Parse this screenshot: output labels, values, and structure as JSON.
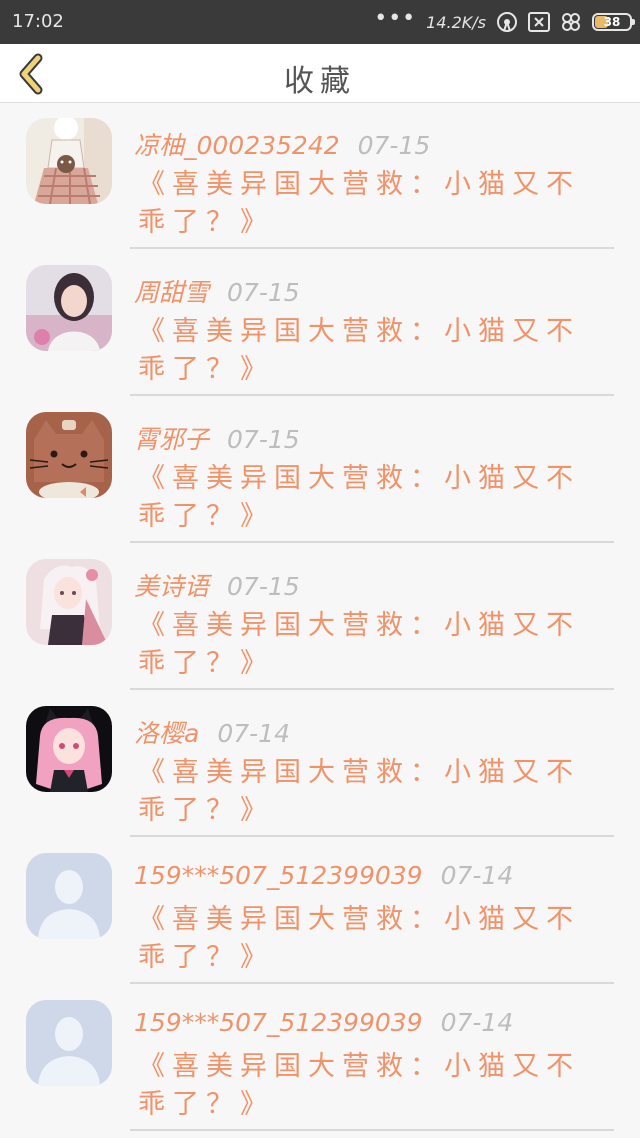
{
  "status_bar": {
    "time": "17:02",
    "dots": "•••",
    "speed": "14.2K/s",
    "battery": "38",
    "battery_level": 0.38
  },
  "header": {
    "title": "收藏",
    "back_icon": "chevron-left-icon"
  },
  "colors": {
    "accent": "#f0936a",
    "date": "#bdbdbd",
    "back_icon": "#f0d27a"
  },
  "items": [
    {
      "name": "凉柚_000235242",
      "date": "07-15",
      "content": "《喜美异国大营救：小猫又不乖了？》",
      "avatar": "anime-girl-plaid-dress"
    },
    {
      "name": "周甜雪",
      "date": "07-15",
      "content": "《喜美异国大营救：小猫又不乖了？》",
      "avatar": "girl-photo"
    },
    {
      "name": "霄邪子",
      "date": "07-15",
      "content": "《喜美异国大营救：小猫又不乖了？》",
      "avatar": "brown-cat"
    },
    {
      "name": "美诗语",
      "date": "07-15",
      "content": "《喜美异国大营救：小猫又不乖了？》",
      "avatar": "anime-girl-pink"
    },
    {
      "name": "洛樱a",
      "date": "07-14",
      "content": "《喜美异国大营救：小猫又不乖了？》",
      "avatar": "anime-girl-cat-ears"
    },
    {
      "name": "159***507_512399039",
      "date": "07-14",
      "content": "《喜美异国大营救：小猫又不乖了？》",
      "avatar": "default-user"
    },
    {
      "name": "159***507_512399039",
      "date": "07-14",
      "content": "《喜美异国大营救：小猫又不乖了？》",
      "avatar": "default-user"
    }
  ]
}
